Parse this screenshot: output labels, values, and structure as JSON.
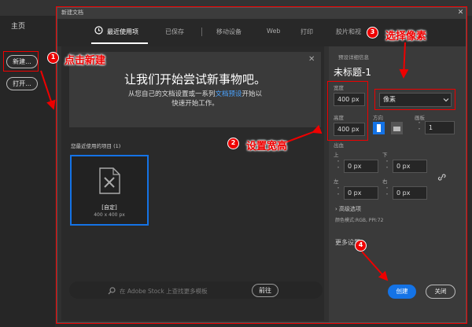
{
  "home": {
    "title": "主页",
    "new_button": "新建...",
    "open_button": "打开..."
  },
  "dialog": {
    "title": "新建文档",
    "close_glyph": "✕",
    "tabs": [
      {
        "label": "最近使用项"
      },
      {
        "label": "已保存"
      },
      {
        "label": "移动设备"
      },
      {
        "label": "Web"
      },
      {
        "label": "打印"
      },
      {
        "label": "胶片和视"
      }
    ],
    "hero": {
      "title": "让我们开始尝试新事物吧。",
      "sub_pre": "从您自己的文档设置或一系列",
      "sub_link": "文档预设",
      "sub_post": "开始以",
      "sub_line2": "快速开始工作。",
      "close_glyph": "✕"
    },
    "recent": {
      "label": "您最近使用的项目 (1)",
      "card_name": "[自定]",
      "card_size": "400 x 400 px"
    },
    "stock": {
      "placeholder": "在 Adobe Stock 上查找更多模板",
      "go_button": "前往"
    },
    "preset": {
      "label": "预设详细信息",
      "name": "未标题-1",
      "width_label": "宽度",
      "width_value": "400 px",
      "unit_value": "像素",
      "height_label": "高度",
      "height_value": "400 px",
      "orientation_label": "方向",
      "artboard_label": "画板",
      "artboard_value": "1",
      "bleed_label": "出血",
      "top_label": "上",
      "top_value": "0 px",
      "bottom_label": "下",
      "bottom_value": "0 px",
      "left_label": "左",
      "left_value": "0 px",
      "right_label": "右",
      "right_value": "0 px",
      "advanced_label": "高级选项",
      "color_mode": "颜色模式:RGB, PPI:72",
      "more_settings": "更多设置"
    },
    "create_button": "创建",
    "close_button": "关闭"
  },
  "annotations": {
    "step1_number": "1",
    "step1_text": "点击新建",
    "step2_number": "2",
    "step2_text": "设置宽高",
    "step3_number": "3",
    "step3_text": "选择像素",
    "step4_number": "4",
    "color": "#e00000"
  }
}
